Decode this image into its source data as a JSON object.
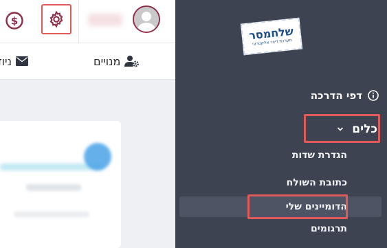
{
  "header": {
    "dollar_icon": "dollar-circle-icon",
    "settings_icon": "gear-icon",
    "avatar_icon": "user-avatar-icon"
  },
  "nav": {
    "subscribers": "מנויים",
    "newsletters": "ניוזל"
  },
  "sidebar": {
    "logo_title": "שלחמסר",
    "logo_subtitle": "מערכת דיוור אלקטרוני",
    "guides": "דפי הדרכה",
    "tools": "כלים",
    "submenu": {
      "field_definitions": "הגדרת שדות",
      "sender_address": "כתובת השולח",
      "my_domains": "הדומיינים שלי",
      "translations": "תרגומים"
    }
  },
  "colors": {
    "sidebar_bg": "#3d4350",
    "accent_maroon": "#8d2f47",
    "highlight_border": "#e05a5a"
  }
}
